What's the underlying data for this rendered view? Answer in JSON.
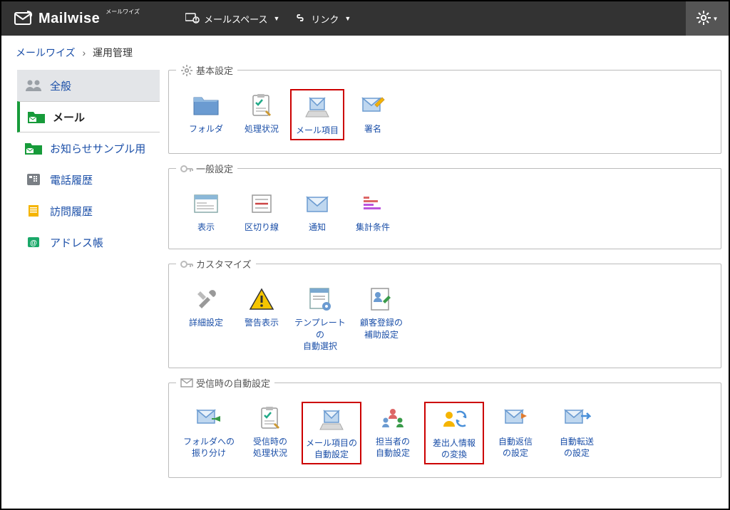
{
  "header": {
    "brand": "Mailwise",
    "brand_sub": "メールワイズ",
    "menu_mailspace": "メールスペース",
    "menu_link": "リンク"
  },
  "breadcrumb": {
    "root": "メールワイズ",
    "sep": "›",
    "current": "運用管理"
  },
  "sidebar": {
    "items": [
      {
        "label": "全般"
      },
      {
        "label": "メール"
      },
      {
        "label": "お知らせサンプル用"
      },
      {
        "label": "電話履歴"
      },
      {
        "label": "訪問履歴"
      },
      {
        "label": "アドレス帳"
      }
    ]
  },
  "sections": {
    "basic": {
      "title": "基本設定",
      "items": [
        {
          "label": "フォルダ"
        },
        {
          "label": "処理状況"
        },
        {
          "label": "メール項目"
        },
        {
          "label": "署名"
        }
      ]
    },
    "general": {
      "title": "一般設定",
      "items": [
        {
          "label": "表示"
        },
        {
          "label": "区切り線"
        },
        {
          "label": "通知"
        },
        {
          "label": "集計条件"
        }
      ]
    },
    "customize": {
      "title": "カスタマイズ",
      "items": [
        {
          "label": "詳細設定"
        },
        {
          "label": "警告表示"
        },
        {
          "label": "テンプレートの\n自動選択"
        },
        {
          "label": "顧客登録の\n補助設定"
        }
      ]
    },
    "receive": {
      "title": "受信時の自動設定",
      "items": [
        {
          "label": "フォルダへの\n振り分け"
        },
        {
          "label": "受信時の\n処理状況"
        },
        {
          "label": "メール項目の\n自動設定"
        },
        {
          "label": "担当者の\n自動設定"
        },
        {
          "label": "差出人情報\nの変換"
        },
        {
          "label": "自動返信\nの設定"
        },
        {
          "label": "自動転送\nの設定"
        }
      ]
    }
  }
}
